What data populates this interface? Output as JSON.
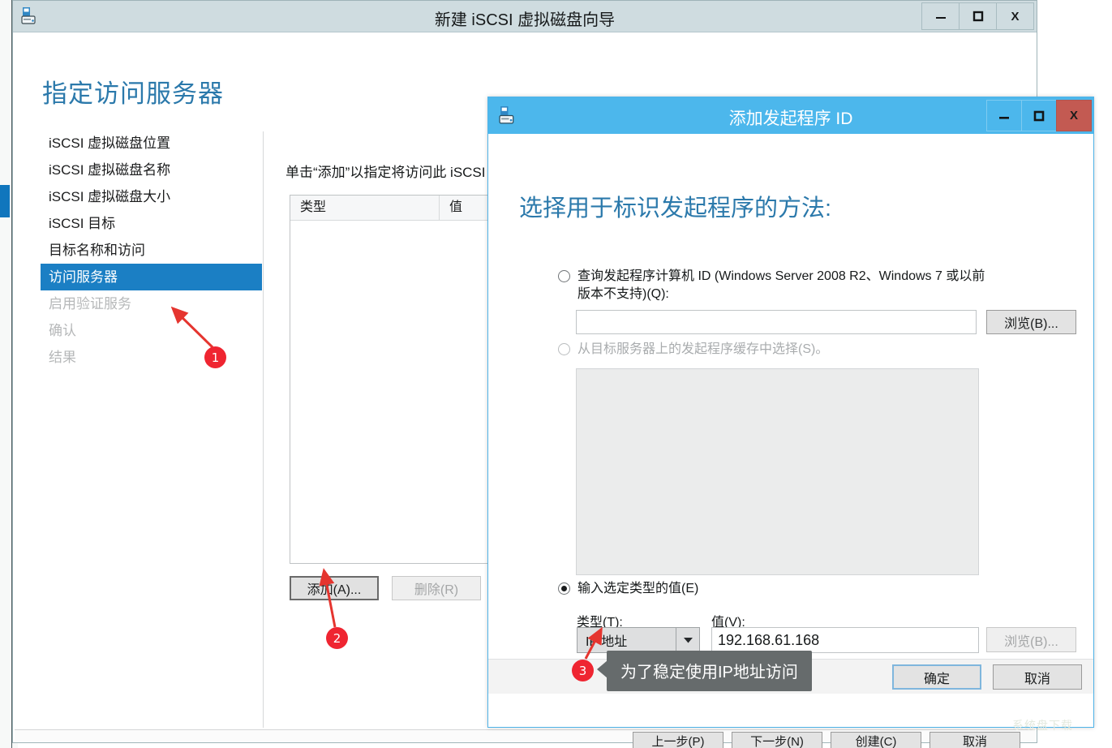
{
  "wizard": {
    "title": "新建 iSCSI 虚拟磁盘向导",
    "icon": "iscsi-disk-icon",
    "window_controls": {
      "minimize": "—",
      "maximize": "❐",
      "close": "X"
    },
    "page_title": "指定访问服务器",
    "sidebar": {
      "items": [
        {
          "label": "iSCSI 虚拟磁盘位置",
          "state": "normal"
        },
        {
          "label": "iSCSI 虚拟磁盘名称",
          "state": "normal"
        },
        {
          "label": "iSCSI 虚拟磁盘大小",
          "state": "normal"
        },
        {
          "label": "iSCSI 目标",
          "state": "normal"
        },
        {
          "label": "目标名称和访问",
          "state": "normal"
        },
        {
          "label": "访问服务器",
          "state": "selected"
        },
        {
          "label": "启用验证服务",
          "state": "disabled"
        },
        {
          "label": "确认",
          "state": "disabled"
        },
        {
          "label": "结果",
          "state": "disabled"
        }
      ]
    },
    "intro_text": "单击“添加”以指定将访问此 iSCSI",
    "grid": {
      "columns": [
        "类型",
        "值"
      ],
      "rows": []
    },
    "add_button": "添加(A)...",
    "remove_button": "删除(R)",
    "footer_buttons": [
      "上一步(P)",
      "下一步(N)",
      "创建(C)",
      "取消"
    ]
  },
  "dialog": {
    "title": "添加发起程序 ID",
    "icon": "iscsi-disk-icon",
    "window_controls": {
      "minimize": "—",
      "maximize": "❐",
      "close": "X"
    },
    "heading": "选择用于标识发起程序的方法:",
    "option_query": {
      "label": "查询发起程序计算机 ID (Windows Server 2008 R2、Windows 7 或以前版本不支持)(Q):",
      "selected": false,
      "input_value": "",
      "browse_button": "浏览(B)..."
    },
    "option_cache": {
      "label": "从目标服务器上的发起程序缓存中选择(S)。",
      "selected": false,
      "disabled": true,
      "list_items": []
    },
    "option_manual": {
      "label": "输入选定类型的值(E)",
      "selected": true,
      "type_label": "类型(T):",
      "type_value": "IP 地址",
      "value_label": "值(V):",
      "value": "192.168.61.168",
      "browse_button": "浏览(B)...",
      "browse_disabled": true
    },
    "footer": {
      "ok": "确定",
      "cancel": "取消"
    }
  },
  "annotations": {
    "markers": [
      {
        "number": "1"
      },
      {
        "number": "2"
      },
      {
        "number": "3"
      }
    ],
    "tooltip": "为了稳定使用IP地址访问",
    "accent_color": "#ef2531"
  },
  "watermark": "系统盘下载"
}
